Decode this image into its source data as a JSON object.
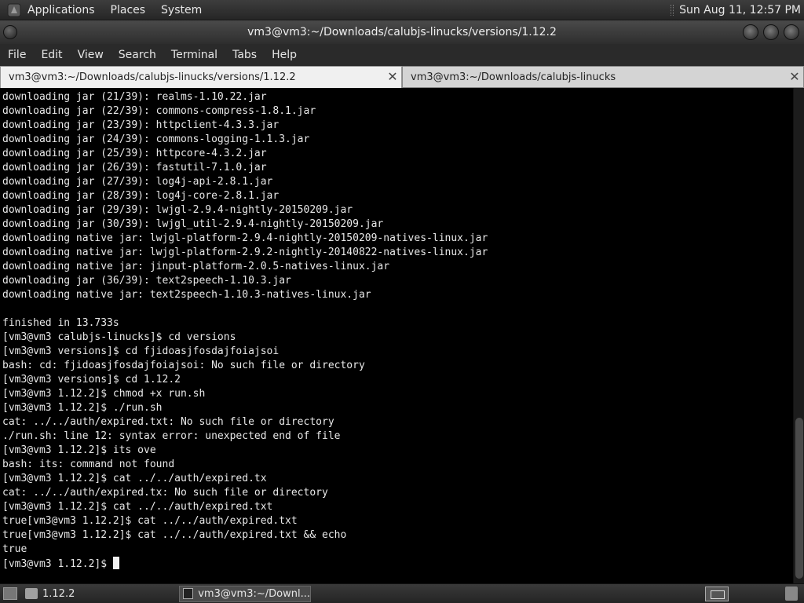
{
  "top_panel": {
    "menus": [
      "Applications",
      "Places",
      "System"
    ],
    "clock": "Sun Aug 11, 12:57 PM"
  },
  "window": {
    "title": "vm3@vm3:~/Downloads/calubjs-linucks/versions/1.12.2"
  },
  "menubar": [
    "File",
    "Edit",
    "View",
    "Search",
    "Terminal",
    "Tabs",
    "Help"
  ],
  "tabs": [
    {
      "label": "vm3@vm3:~/Downloads/calubjs-linucks/versions/1.12.2",
      "close": "✕"
    },
    {
      "label": "vm3@vm3:~/Downloads/calubjs-linucks",
      "close": "✕"
    }
  ],
  "terminal": {
    "lines": [
      "downloading jar (21/39): realms-1.10.22.jar",
      "downloading jar (22/39): commons-compress-1.8.1.jar",
      "downloading jar (23/39): httpclient-4.3.3.jar",
      "downloading jar (24/39): commons-logging-1.1.3.jar",
      "downloading jar (25/39): httpcore-4.3.2.jar",
      "downloading jar (26/39): fastutil-7.1.0.jar",
      "downloading jar (27/39): log4j-api-2.8.1.jar",
      "downloading jar (28/39): log4j-core-2.8.1.jar",
      "downloading jar (29/39): lwjgl-2.9.4-nightly-20150209.jar",
      "downloading jar (30/39): lwjgl_util-2.9.4-nightly-20150209.jar",
      "downloading native jar: lwjgl-platform-2.9.4-nightly-20150209-natives-linux.jar",
      "downloading native jar: lwjgl-platform-2.9.2-nightly-20140822-natives-linux.jar",
      "downloading native jar: jinput-platform-2.0.5-natives-linux.jar",
      "downloading jar (36/39): text2speech-1.10.3.jar",
      "downloading native jar: text2speech-1.10.3-natives-linux.jar",
      "",
      "finished in 13.733s",
      "[vm3@vm3 calubjs-linucks]$ cd versions",
      "[vm3@vm3 versions]$ cd fjidoasjfosdajfoiajsoi",
      "bash: cd: fjidoasjfosdajfoiajsoi: No such file or directory",
      "[vm3@vm3 versions]$ cd 1.12.2",
      "[vm3@vm3 1.12.2]$ chmod +x run.sh",
      "[vm3@vm3 1.12.2]$ ./run.sh",
      "cat: ../../auth/expired.txt: No such file or directory",
      "./run.sh: line 12: syntax error: unexpected end of file",
      "[vm3@vm3 1.12.2]$ its ove",
      "bash: its: command not found",
      "[vm3@vm3 1.12.2]$ cat ../../auth/expired.tx",
      "cat: ../../auth/expired.tx: No such file or directory",
      "[vm3@vm3 1.12.2]$ cat ../../auth/expired.txt",
      "true[vm3@vm3 1.12.2]$ cat ../../auth/expired.txt",
      "true[vm3@vm3 1.12.2]$ cat ../../auth/expired.txt && echo",
      "true"
    ],
    "prompt": "[vm3@vm3 1.12.2]$ "
  },
  "taskbar": {
    "tasks": [
      {
        "label": "1.12.2",
        "icon": "folder-icon"
      },
      {
        "label": "vm3@vm3:~/Downl...",
        "icon": "terminal-icon"
      }
    ]
  }
}
